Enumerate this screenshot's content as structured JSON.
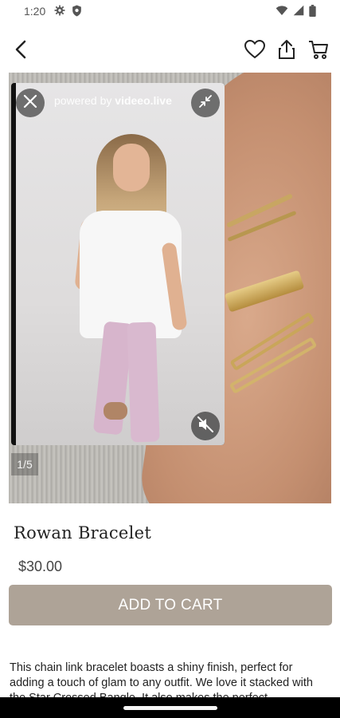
{
  "status_bar": {
    "time": "1:20",
    "left_icons": [
      "gear-icon",
      "shield-icon"
    ],
    "right_icons": [
      "wifi-icon",
      "signal-icon",
      "battery-icon"
    ]
  },
  "app_bar": {
    "back_icon": "back-arrow-icon",
    "actions": [
      "heart-icon",
      "share-icon",
      "cart-icon"
    ]
  },
  "product_image": {
    "page_indicator": "1/5"
  },
  "video_overlay": {
    "powered_prefix": "powered by ",
    "powered_brand": "videeo.live",
    "close_icon": "close-icon",
    "minimize_icon": "minimize-icon",
    "mute_icon": "volume-off-icon"
  },
  "product": {
    "title": "Rowan Bracelet",
    "price": "$30.00",
    "add_to_cart_label": "ADD TO CART",
    "description": "This chain link bracelet boasts a shiny finish, perfect for adding a touch of glam to any outfit. We love it stacked with the Star Crossed Bangle. It also makes the perfect"
  },
  "colors": {
    "button_bg": "#aea397",
    "button_text": "#ffffff",
    "text_primary": "#222222"
  }
}
